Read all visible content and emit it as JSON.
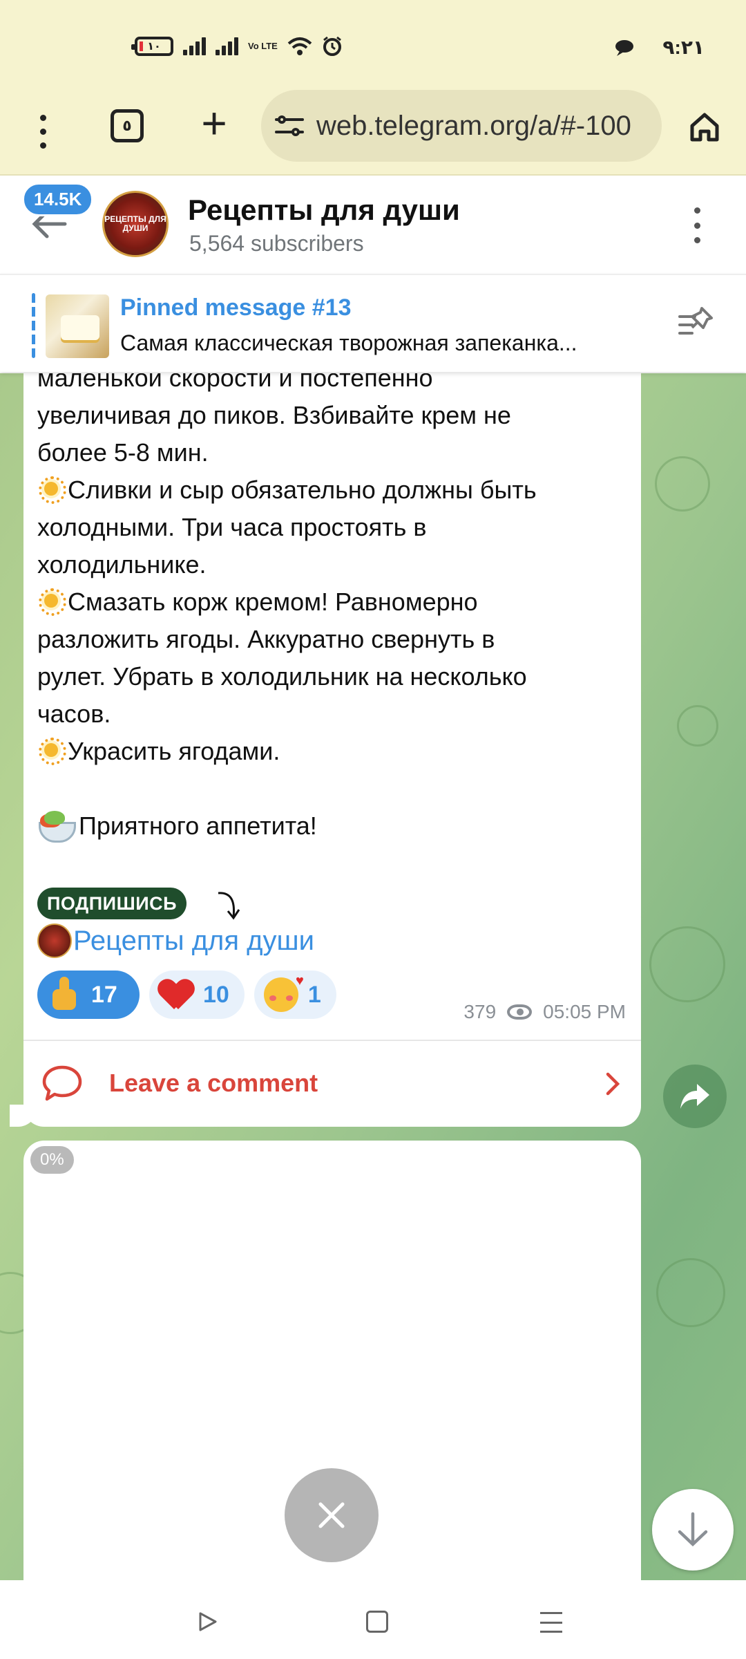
{
  "status_bar": {
    "battery": "١٠",
    "network_label": "Vo LTE",
    "time": "٩:٢١"
  },
  "browser": {
    "tab_count": "٥",
    "url": "web.telegram.org/a/#-100",
    "icons": [
      "menu-dots-icon",
      "tabs-icon",
      "plus-icon",
      "site-settings-icon",
      "home-icon"
    ]
  },
  "chat_header": {
    "unread_count": "14.5K",
    "title": "Рецепты для души",
    "subscribers": "5,564 subscribers",
    "avatar_text": "РЕЦЕПТЫ ДЛЯ ДУШИ"
  },
  "pinned": {
    "title": "Pinned message #13",
    "text": "Самая классическая творожная запеканка..."
  },
  "message": {
    "lines": [
      "маленькой скорости и постепенно",
      "увеличивая до пиков. Взбивайте крем не",
      "более 5-8 мин.",
      "Сливки и сыр обязательно должны быть",
      "холодными. Три часа простоять в",
      "холодильнике.",
      "Смазать корж кремом! Равномерно",
      "разложить ягоды. Аккуратно свернуть в",
      "рулет. Убрать в холодильник на несколько",
      "часов.",
      "Украсить ягодами.",
      "",
      "Приятного аппетита!"
    ],
    "subscribe_badge": "ПОДПИШИСЬ",
    "channel_link": "Рецепты для души",
    "reactions": [
      {
        "emoji": "thumbs-up",
        "count": "17"
      },
      {
        "emoji": "heart",
        "count": "10"
      },
      {
        "emoji": "smiling-face-with-hearts",
        "count": "1"
      }
    ],
    "views": "379",
    "time": "05:05 PM",
    "comment_label": "Leave a comment"
  },
  "loading": {
    "progress": "0%"
  }
}
